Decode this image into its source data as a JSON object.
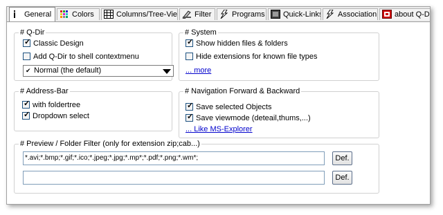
{
  "tabs": [
    {
      "label": "General",
      "icon": "info-icon",
      "active": true
    },
    {
      "label": "Colors",
      "icon": "colors-icon",
      "active": false
    },
    {
      "label": "Columns/Tree-View",
      "icon": "columns-icon",
      "active": false
    },
    {
      "label": "Filter",
      "icon": "filter-icon",
      "active": false
    },
    {
      "label": "Programs",
      "icon": "programs-icon",
      "active": false
    },
    {
      "label": "Quick-Links",
      "icon": "quick-links-icon",
      "active": false
    },
    {
      "label": "Association",
      "icon": "association-icon",
      "active": false
    },
    {
      "label": "about Q-Dir ...",
      "icon": "about-icon",
      "active": false
    }
  ],
  "qdir": {
    "title": "# Q-Dir",
    "classic_design": {
      "label": "Classic Design",
      "checked": true
    },
    "shell_context": {
      "label": "Add Q-Dir to shell contextmenu",
      "checked": false
    },
    "mode_select": {
      "value": "Normal (the default)"
    }
  },
  "system": {
    "title": "# System",
    "show_hidden": {
      "label": "Show hidden files & folders",
      "checked": true
    },
    "hide_ext": {
      "label": "Hide extensions for known file types",
      "checked": false
    },
    "more_link": "... more"
  },
  "address_bar": {
    "title": "# Address-Bar",
    "with_foldertree": {
      "label": "with foldertree",
      "checked": true
    },
    "dropdown_select": {
      "label": "Dropdown select",
      "checked": true
    }
  },
  "navigation": {
    "title": "# Navigation Forward & Backward",
    "save_selected": {
      "label": "Save selected Objects",
      "checked": true
    },
    "save_viewmode": {
      "label": "Save viewmode (deteail,thums,...)",
      "checked": true
    },
    "like_link": "... Like MS-Explorer"
  },
  "preview": {
    "title": "# Preview / Folder Filter (only for extension zip;cab...)",
    "filter_value": "*.avi;*.bmp;*.gif;*.ico;*.jpeg;*.jpg;*.mp*;*.pdf;*.png;*.wm*;",
    "filter2_value": "",
    "def_label": "Def."
  }
}
